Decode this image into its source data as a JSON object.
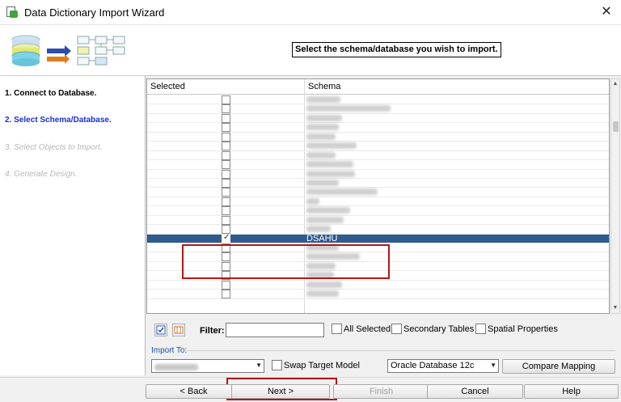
{
  "window": {
    "title": "Data Dictionary Import Wizard"
  },
  "header": {
    "instruction": "Select the schema/database you wish to import."
  },
  "steps": [
    {
      "label": "1. Connect to Database.",
      "state": "done"
    },
    {
      "label": "2. Select Schema/Database.",
      "state": "current"
    },
    {
      "label": "3. Select Objects to Import.",
      "state": "future"
    },
    {
      "label": "4. Generate Design.",
      "state": "future"
    }
  ],
  "grid": {
    "columns": [
      "Selected",
      "Schema"
    ],
    "selected_row": {
      "schema": "DSAHU",
      "checked": true
    }
  },
  "filterbar": {
    "filter_label": "Filter:",
    "filter_value": "",
    "all_selected_label": "All Selected",
    "secondary_tables_label": "Secondary Tables",
    "spatial_properties_label": "Spatial Properties"
  },
  "import_to": {
    "label": "Import To:",
    "swap_target_label": "Swap Target Model",
    "db_type": "Oracle Database 12c",
    "compare_mapping_label": "Compare Mapping"
  },
  "footer": {
    "back_label": "< Back",
    "next_label": "Next >",
    "finish_label": "Finish",
    "cancel_label": "Cancel",
    "help_label": "Help"
  },
  "colors": {
    "selection": "#2f5b8f",
    "current_step": "#1a2ed6",
    "highlight_box": "#b01818"
  },
  "icons": [
    "app-icon",
    "close-icon",
    "check-all-icon",
    "uncheck-all-icon",
    "chevron-down-icon"
  ]
}
